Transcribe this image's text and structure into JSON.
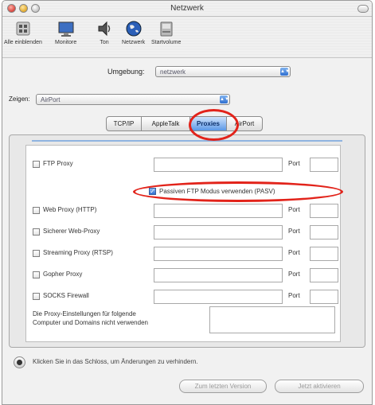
{
  "window": {
    "title": "Netzwerk"
  },
  "toolbar": {
    "items": [
      {
        "label": "Alle einblenden",
        "icon": "grid-icon"
      },
      {
        "label": "Monitore",
        "icon": "monitor-icon"
      },
      {
        "label": "Ton",
        "icon": "speaker-icon"
      },
      {
        "label": "Netzwerk",
        "icon": "globe-icon"
      },
      {
        "label": "Startvolume",
        "icon": "disk-icon"
      }
    ]
  },
  "location": {
    "label": "Umgebung:",
    "value": "netzwerk"
  },
  "show": {
    "label": "Zeigen:",
    "value": "AirPort"
  },
  "tabs": [
    {
      "label": "TCP/IP",
      "active": false
    },
    {
      "label": "AppleTalk",
      "active": false
    },
    {
      "label": "Proxies",
      "active": true
    },
    {
      "label": "AirPort",
      "active": false
    }
  ],
  "proxies": {
    "port_label": "Port",
    "rows": [
      {
        "label": "FTP Proxy"
      },
      {
        "label": "Web Proxy (HTTP)"
      },
      {
        "label": "Sicherer Web-Proxy"
      },
      {
        "label": "Streaming Proxy (RTSP)"
      },
      {
        "label": "Gopher Proxy"
      },
      {
        "label": "SOCKS Firewall"
      }
    ],
    "passive_ftp": {
      "label": "Passiven FTP Modus verwenden (PASV)",
      "checked": true
    },
    "bypass_label_line1": "Die Proxy-Einstellungen für folgende",
    "bypass_label_line2": "Computer und Domains nicht verwenden"
  },
  "lock": {
    "text": "Klicken Sie in das Schloss, um Änderungen zu verhindern."
  },
  "buttons": {
    "revert": "Zum letzten Version",
    "apply": "Jetzt aktivieren"
  },
  "colors": {
    "accent": "#3a7bd5",
    "annotation": "#e2231a"
  }
}
